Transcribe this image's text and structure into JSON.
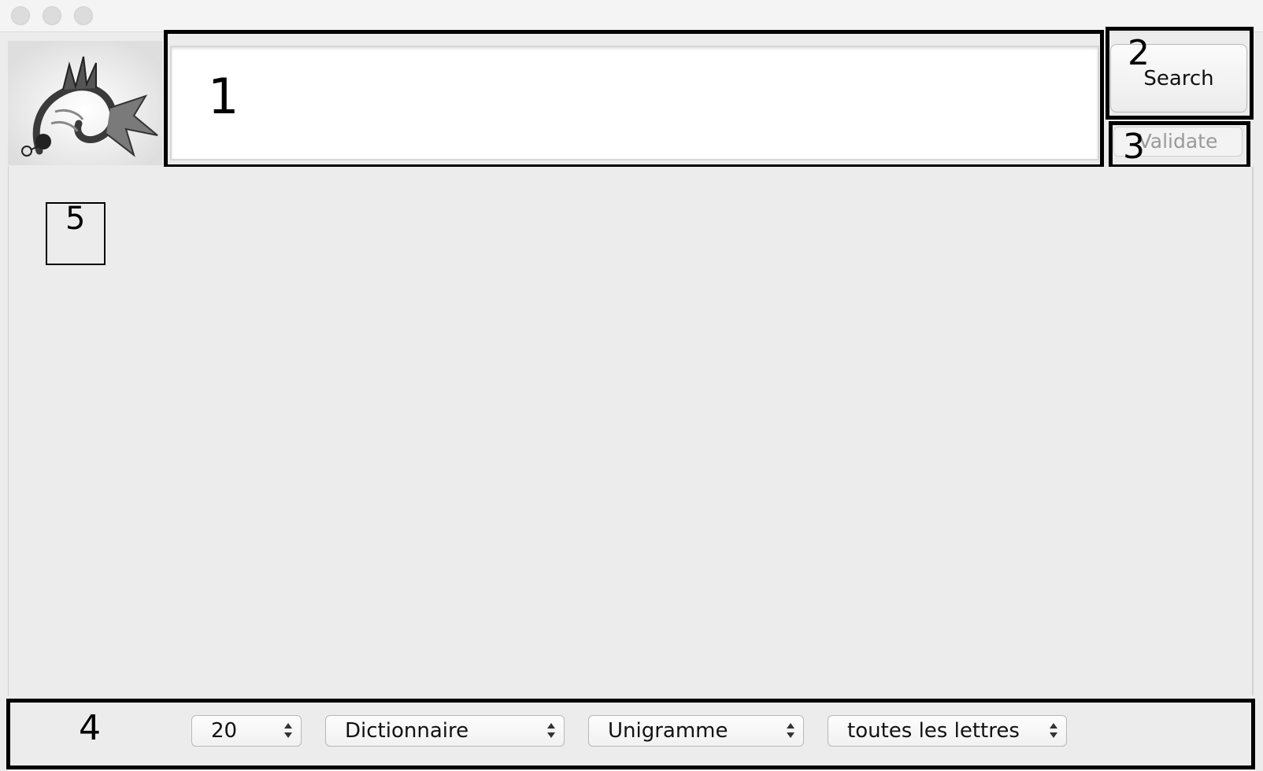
{
  "window": {
    "controls": [
      "close",
      "minimize",
      "zoom"
    ]
  },
  "logo": {
    "icon": "dragon-fish-icon"
  },
  "search": {
    "value": "",
    "button_label": "Search",
    "validate_label": "Validate"
  },
  "annotations": {
    "search_field": "1",
    "search_button": "2",
    "validate_button": "3",
    "options_bar": "4",
    "results_area": "5"
  },
  "options": {
    "count": "20",
    "source": "Dictionnaire",
    "ngram": "Unigramme",
    "letters": "toutes les lettres"
  },
  "colors": {
    "window_bg": "#ececec",
    "annotation": "#000000",
    "disabled_text": "#9a9a9a"
  }
}
